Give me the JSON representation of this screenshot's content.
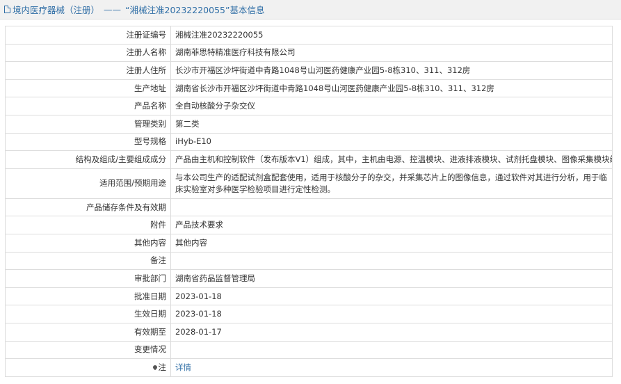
{
  "header": {
    "category": "境内医疗器械（注册）",
    "separator": "——",
    "title": "“湘械注准20232220055”基本信息"
  },
  "rows": [
    {
      "label": "注册证编号",
      "value": "湘械注准20232220055"
    },
    {
      "label": "注册人名称",
      "value": "湖南菲思特精准医疗科技有限公司"
    },
    {
      "label": "注册人住所",
      "value": "长沙市开福区沙坪街道中青路1048号山河医药健康产业园5-8栋310、311、312房"
    },
    {
      "label": "生产地址",
      "value": "湖南省长沙市开福区沙坪街道中青路1048号山河医药健康产业园5-8栋310、311、312房"
    },
    {
      "label": "产品名称",
      "value": "全自动核酸分子杂交仪"
    },
    {
      "label": "管理类别",
      "value": "第二类"
    },
    {
      "label": "型号规格",
      "value": "iHyb-E10"
    },
    {
      "label": "结构及组成/主要组成成分",
      "value": "产品由主机和控制软件（发布版本V1）组成，其中，主机由电源、控温模块、进液排液模块、试剂托盘模块、图像采集模块组成。"
    },
    {
      "label": "适用范围/预期用途",
      "value": "与本公司生产的适配试剂盒配套使用，适用于核酸分子的杂交，并采集芯片上的图像信息，通过软件对其进行分析，用于临床实验室对多种医学检验项目进行定性检测。"
    },
    {
      "label": "产品储存条件及有效期",
      "value": ""
    },
    {
      "label": "附件",
      "value": "产品技术要求"
    },
    {
      "label": "其他内容",
      "value": "其他内容"
    },
    {
      "label": "备注",
      "value": ""
    },
    {
      "label": "审批部门",
      "value": "湖南省药品监督管理局"
    },
    {
      "label": "批准日期",
      "value": "2023-01-18"
    },
    {
      "label": "生效日期",
      "value": "2023-01-18"
    },
    {
      "label": "有效期至",
      "value": "2028-01-17"
    },
    {
      "label": "变更情况",
      "value": ""
    },
    {
      "label": "注",
      "value": "详情"
    }
  ],
  "icons": {
    "title_icon": "document-icon",
    "note_icon": "pin-icon"
  },
  "colors": {
    "link": "#2f6ea6",
    "title_bar_bg": "#f1f1f1",
    "border": "#dcdcdc"
  }
}
